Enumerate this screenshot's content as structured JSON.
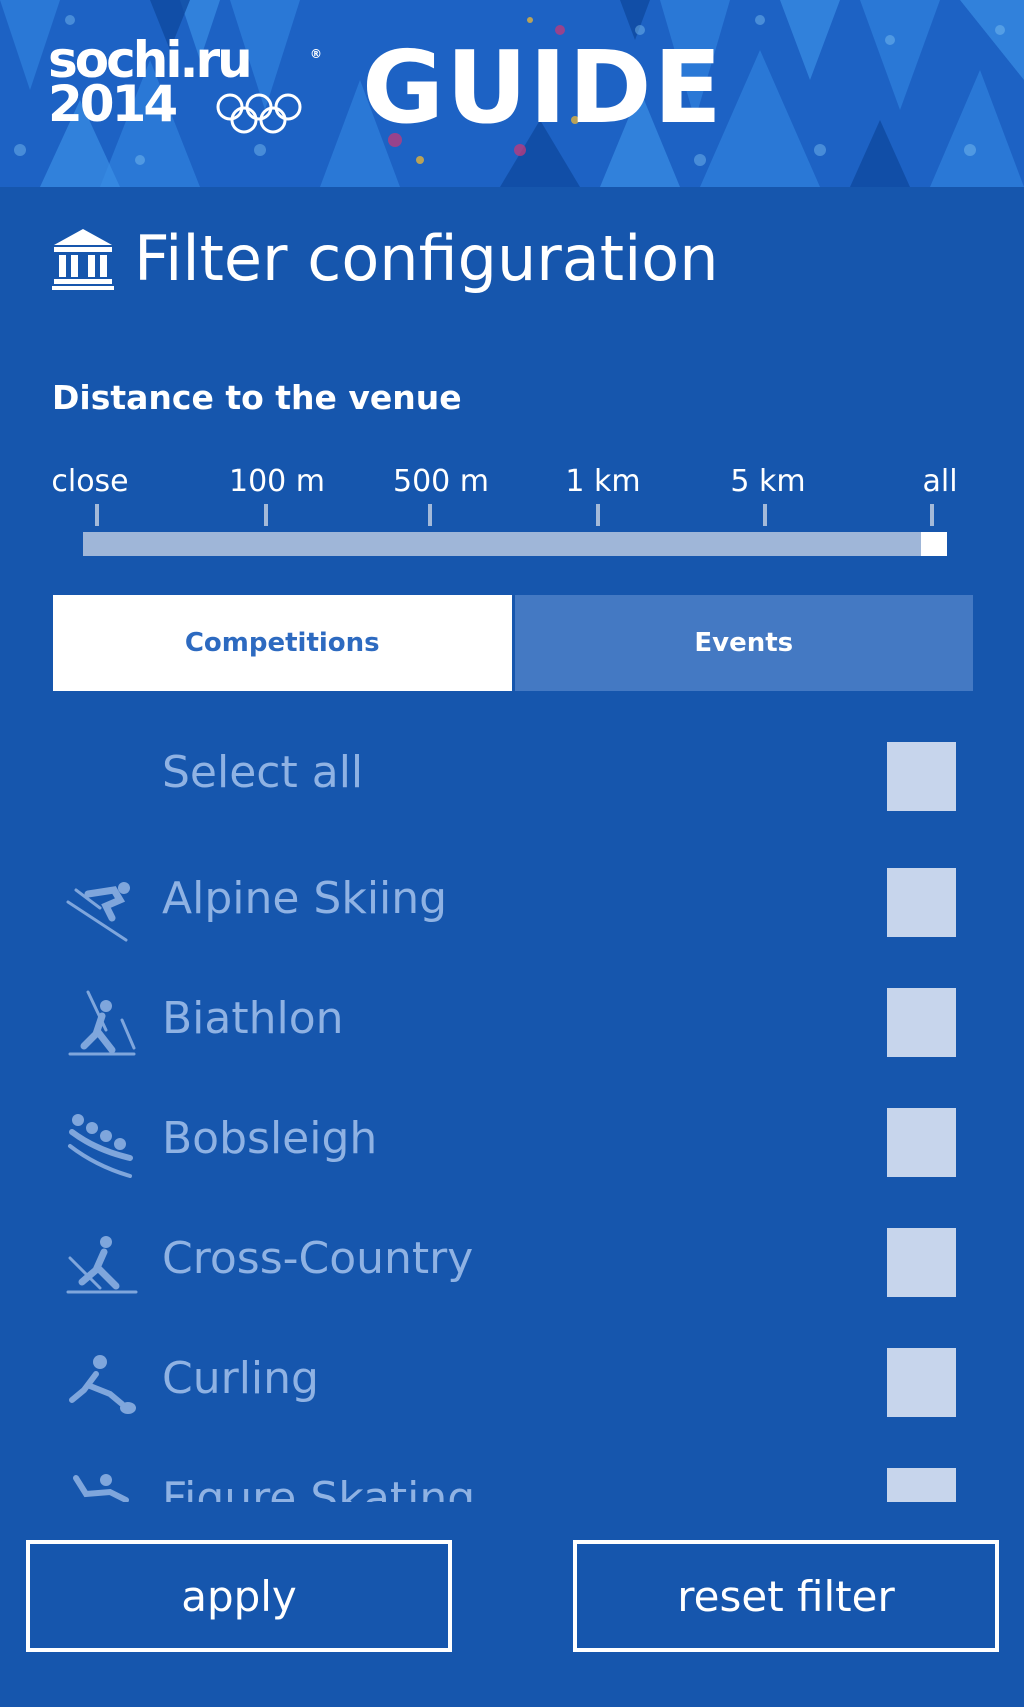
{
  "header": {
    "logo_line1": "sochi.ru",
    "logo_line2": "2014",
    "logo_registered": "®",
    "guide_title": "GUIDE"
  },
  "page": {
    "title": "Filter configuration",
    "title_icon": "building-columns-icon"
  },
  "distance": {
    "label": "Distance to the venue",
    "steps": [
      "close",
      "100 m",
      "500 m",
      "1 km",
      "5 km",
      "all"
    ],
    "selected": "all",
    "selected_fraction": 1.0
  },
  "tabs": [
    {
      "label": "Competitions",
      "active": true
    },
    {
      "label": "Events",
      "active": false
    }
  ],
  "list": {
    "select_all_label": "Select all",
    "items": [
      {
        "label": "Alpine Skiing",
        "icon": "alpine-skiing-icon",
        "checked": false
      },
      {
        "label": "Biathlon",
        "icon": "biathlon-icon",
        "checked": false
      },
      {
        "label": "Bobsleigh",
        "icon": "bobsleigh-icon",
        "checked": false
      },
      {
        "label": "Cross-Country",
        "icon": "cross-country-icon",
        "checked": false
      },
      {
        "label": "Curling",
        "icon": "curling-icon",
        "checked": false
      },
      {
        "label": "Figure Skating",
        "icon": "figure-skating-icon",
        "checked": false
      }
    ]
  },
  "buttons": {
    "apply": "apply",
    "reset": "reset filter"
  },
  "colors": {
    "background": "#1656ad",
    "active_tab_text": "#2d6ac0",
    "inactive_tab": "#4479c3",
    "checkbox": "#c7d5ec",
    "list_text": "#8fb2e3"
  }
}
